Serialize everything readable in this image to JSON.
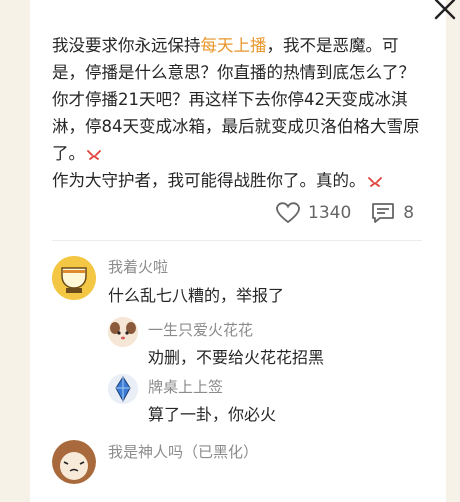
{
  "post": {
    "text_before": "我没要求你永远保持",
    "highlight": "每天上播",
    "text_after": "，我不是恶魔。可是，停播是什么意思？你直播的热情到底怎么了？你才停播21天吧？再这样下去你停42天变成冰淇淋，停84天变成冰箱，最后就变成贝洛伯格大雪原了。",
    "line2": "作为大守护者，我可能得战胜你了。真的。",
    "highlight_color": "#e8962a"
  },
  "actions": {
    "like_count": "1340",
    "comment_count": "8",
    "like_icon": "heart-icon",
    "comment_icon": "comment-icon"
  },
  "comments": [
    {
      "name": "我着火啦",
      "text": "什么乱七八糟的，举报了",
      "avatar": "cup-avatar"
    },
    {
      "name": "一生只爱火花花",
      "text": "劝删，不要给火花花招黑",
      "avatar": "puppy-avatar"
    },
    {
      "name": "牌桌上上签",
      "text": "算了一卦，你必火",
      "avatar": "crystal-avatar"
    },
    {
      "name": "我是神人吗（已黑化）",
      "text": "",
      "avatar": "cat-avatar"
    }
  ],
  "close_icon": "close-icon"
}
